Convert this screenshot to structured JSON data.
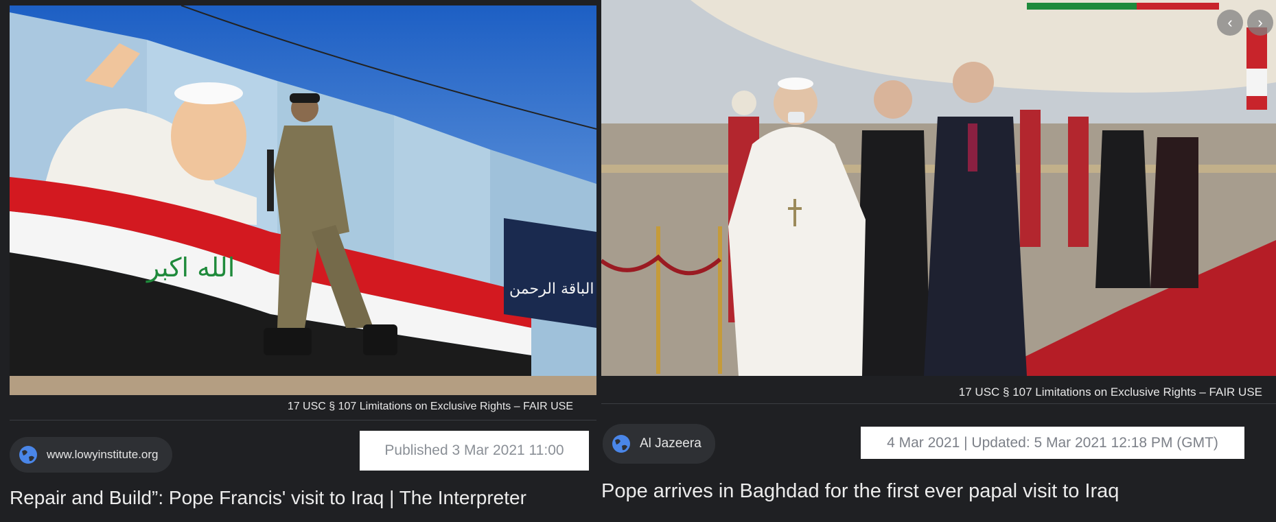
{
  "left": {
    "fair_use": "17 USC § 107 Limitations on Exclusive Rights – FAIR USE",
    "source": "www.lowyinstitute.org",
    "date": "Published 3 Mar 2021 11:00",
    "title": "Repair and Build”: Pope Francis' visit to Iraq | The Interpreter",
    "mural_text": "الله اكبر",
    "sign_text": "الباقة الرحمن"
  },
  "right": {
    "fair_use": "17 USC § 107 Limitations on Exclusive Rights – FAIR USE",
    "source": "Al Jazeera",
    "date": "4 Mar 2021 | Updated: 5 Mar 2021 12:18 PM (GMT)",
    "title": "Pope arrives in Baghdad for the first ever papal visit to Iraq",
    "prev_icon": "‹",
    "next_icon": "›"
  },
  "icons": [
    "globe-icon",
    "chevron-left-icon",
    "chevron-right-icon"
  ],
  "colors": {
    "background": "#1f2023",
    "chip": "#2e3034",
    "globe": "#4a86e8"
  }
}
